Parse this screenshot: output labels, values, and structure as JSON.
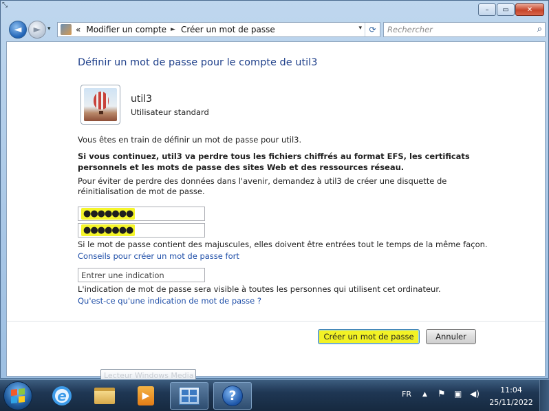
{
  "window": {
    "corner_glyph": "⤡",
    "minimize": "–",
    "maximize": "▭",
    "close": "✕"
  },
  "nav": {
    "back": "◄",
    "forward": "►",
    "dropdown": "▾",
    "chevrons": "«",
    "breadcrumb_1": "Modifier un compte",
    "breadcrumb_sep": "►",
    "breadcrumb_2": "Créer un mot de passe",
    "address_dropdown": "▾",
    "refresh": "⟳",
    "search_placeholder": "Rechercher",
    "search_icon": "⌕"
  },
  "content": {
    "heading": "Définir un mot de passe pour le compte de util3",
    "user_name": "util3",
    "user_type": "Utilisateur standard",
    "intro": "Vous êtes en train de définir un mot de passe pour util3.",
    "warning": "Si vous continuez, util3 va perdre tous les fichiers chiffrés au format EFS, les certificats personnels et les mots de passe des sites Web et des ressources réseau.",
    "advice": "Pour éviter de perdre des données dans l'avenir, demandez à util3 de créer une disquette de réinitialisation de mot de passe.",
    "password_mask": "●●●●●●●",
    "confirm_mask": "●●●●●●●",
    "case_note": "Si le mot de passe contient des majuscules, elles doivent être entrées tout le temps de la même façon.",
    "strong_link": "Conseils pour créer un mot de passe fort",
    "hint_placeholder": "Entrer une indication",
    "hint_note": "L'indication de mot de passe sera visible à toutes les personnes qui utilisent cet ordinateur.",
    "hint_link": "Qu'est-ce qu'une indication de mot de passe ?",
    "create_button": "Créer un mot de passe",
    "cancel_button": "Annuler"
  },
  "tooltip": "Lecteur Windows Media",
  "taskbar": {
    "ie_glyph": "e",
    "media_glyph": "▶",
    "help_glyph": "?",
    "language": "FR",
    "tray_up": "▲",
    "tray_flag": "⚑",
    "tray_net": "▣",
    "tray_vol": "◀)",
    "time": "11:04",
    "date": "25/11/2022"
  },
  "colors": {
    "heading": "#1e3f8a",
    "link": "#1e4ea8",
    "highlight": "#f2f226"
  }
}
